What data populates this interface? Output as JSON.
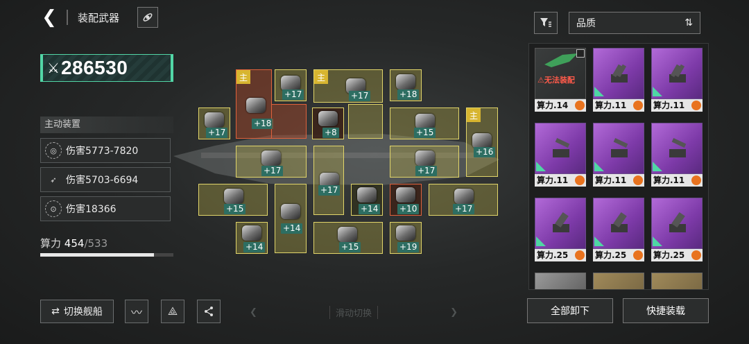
{
  "header": {
    "back_icon": "chevron-left-icon",
    "title": "装配武器",
    "ship_icon": "ship-swap-icon"
  },
  "power": {
    "icon": "crossed-swords-icon",
    "value": "286530"
  },
  "devices": {
    "heading": "主动装置",
    "items": [
      {
        "icon": "target-icon",
        "label": "伤害5773-7820"
      },
      {
        "icon": "missile-icon",
        "label": "伤害5703-6694"
      },
      {
        "icon": "shield-icon",
        "label": "伤害18366"
      }
    ]
  },
  "calc": {
    "label": "算力",
    "current": "454",
    "sep": "/",
    "max": "533",
    "fraction": 0.852
  },
  "buttons": {
    "swap_ship": "切换舰船",
    "swap_icon": "swap-arrows-icon",
    "wave_icon": "waveform-icon",
    "fleet_icon": "fleet-icon",
    "share_icon": "share-icon",
    "slide_hint": "滑动切换",
    "unequip_all": "全部卸下",
    "quick_equip": "快捷装载"
  },
  "slots": {
    "main_tag": "主",
    "levels": [
      "+17",
      "+18",
      "+17",
      "+18",
      "+17",
      "+8",
      "+15",
      "+16",
      "+17",
      "+17",
      "+17",
      "+15",
      "+14",
      "+14",
      "+10",
      "+17",
      "+14",
      "+15",
      "+19"
    ]
  },
  "sort": {
    "filter_icon": "filter-icon",
    "label": "品质",
    "sort_icon": "sort-toggle-icon"
  },
  "inventory": {
    "locked_text": "无法装配",
    "cards": [
      {
        "rarity": "locked",
        "cost": "算力.14"
      },
      {
        "rarity": "purple",
        "cost": "算力.11"
      },
      {
        "rarity": "purple",
        "cost": "算力.11"
      },
      {
        "rarity": "purple",
        "cost": "算力.11"
      },
      {
        "rarity": "purple",
        "cost": "算力.11"
      },
      {
        "rarity": "purple",
        "cost": "算力.11"
      },
      {
        "rarity": "purple",
        "cost": "算力.25"
      },
      {
        "rarity": "purple",
        "cost": "算力.25"
      },
      {
        "rarity": "purple",
        "cost": "算力.25"
      }
    ]
  }
}
